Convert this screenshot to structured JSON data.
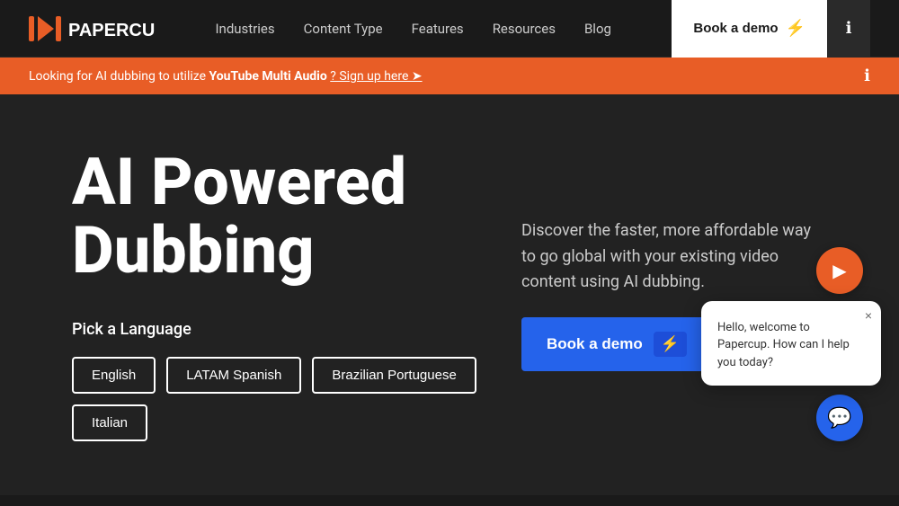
{
  "navbar": {
    "logo_alt": "Papercup",
    "links": [
      {
        "id": "industries",
        "label": "Industries"
      },
      {
        "id": "content-type",
        "label": "Content Type"
      },
      {
        "id": "features",
        "label": "Features"
      },
      {
        "id": "resources",
        "label": "Resources"
      },
      {
        "id": "blog",
        "label": "Blog"
      }
    ],
    "cta_label": "Book a demo",
    "info_icon": "ℹ"
  },
  "banner": {
    "prefix": "Looking for AI dubbing to utilize ",
    "highlight": "YouTube Multi Audio",
    "suffix": "? Sign up here ➤",
    "info_icon": "ℹ"
  },
  "hero": {
    "title_line1": "AI Powered",
    "title_line2": "Dubbing",
    "tagline": "Discover the faster, more affordable way to go global with your existing video content using AI dubbing.",
    "cta_label": "Book a demo",
    "pick_language_label": "Pick a Language",
    "languages": [
      {
        "id": "english",
        "label": "English"
      },
      {
        "id": "latam-spanish",
        "label": "LATAM Spanish"
      },
      {
        "id": "brazilian-portuguese",
        "label": "Brazilian Portuguese"
      },
      {
        "id": "italian",
        "label": "Italian"
      }
    ]
  },
  "chat": {
    "welcome_text": "Hello, welcome to Papercup. How can I help you today?",
    "close_label": "×",
    "avatar_icon": "▶",
    "trigger_icon": "💬"
  },
  "colors": {
    "orange": "#e85d26",
    "blue": "#2563eb",
    "dark": "#1a1a1a",
    "medium_dark": "#222"
  }
}
